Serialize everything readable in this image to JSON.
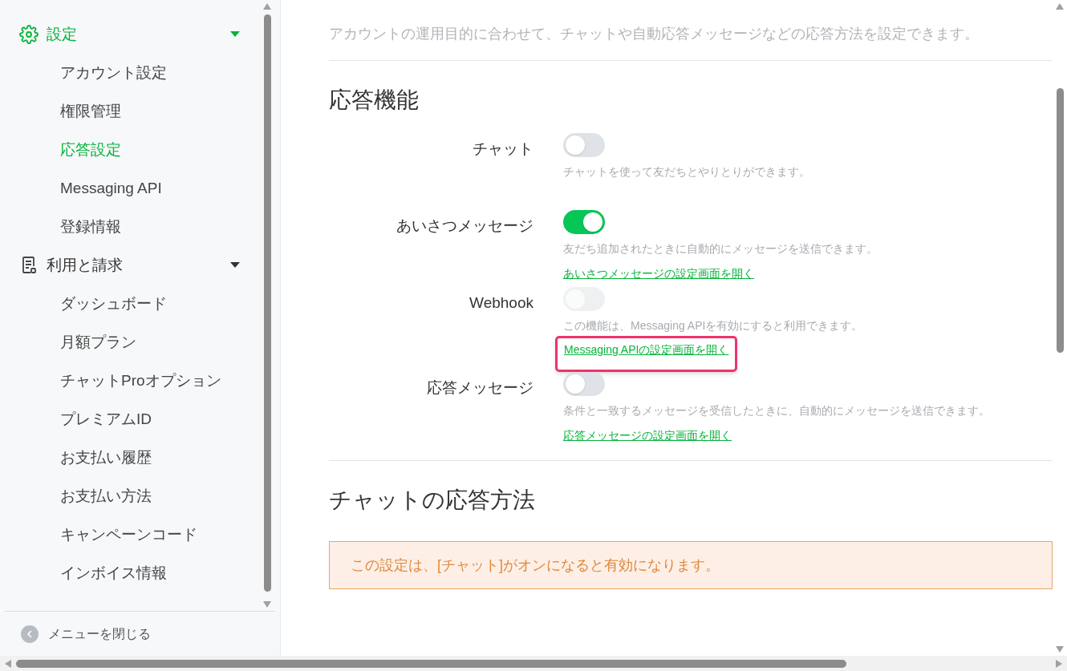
{
  "sidebar": {
    "sections": [
      {
        "label": "設定",
        "expanded": true,
        "selected": true,
        "items": [
          {
            "label": "アカウント設定",
            "selected": false
          },
          {
            "label": "権限管理",
            "selected": false
          },
          {
            "label": "応答設定",
            "selected": true
          },
          {
            "label": "Messaging API",
            "selected": false
          },
          {
            "label": "登録情報",
            "selected": false
          }
        ]
      },
      {
        "label": "利用と請求",
        "expanded": true,
        "selected": false,
        "items": [
          {
            "label": "ダッシュボード",
            "selected": false
          },
          {
            "label": "月額プラン",
            "selected": false
          },
          {
            "label": "チャットProオプション",
            "selected": false
          },
          {
            "label": "プレミアムID",
            "selected": false
          },
          {
            "label": "お支払い履歴",
            "selected": false
          },
          {
            "label": "お支払い方法",
            "selected": false
          },
          {
            "label": "キャンペーンコード",
            "selected": false
          },
          {
            "label": "インボイス情報",
            "selected": false
          }
        ]
      }
    ],
    "close_menu": "メニューを閉じる"
  },
  "page": {
    "description": "アカウントの運用目的に合わせて、チャットや自動応答メッセージなどの応答方法を設定できます。"
  },
  "response_features": {
    "heading": "応答機能",
    "rows": [
      {
        "label": "チャット",
        "on": false,
        "disabled": false,
        "description": "チャットを使って友だちとやりとりができます。"
      },
      {
        "label": "あいさつメッセージ",
        "on": true,
        "disabled": false,
        "description": "友だち追加されたときに自動的にメッセージを送信できます。",
        "link": "あいさつメッセージの設定画面を開く",
        "highlighted": false
      },
      {
        "label": "Webhook",
        "on": false,
        "disabled": true,
        "description": "この機能は、Messaging APIを有効にすると利用できます。",
        "link": "Messaging APIの設定画面を開く",
        "highlighted": true
      },
      {
        "label": "応答メッセージ",
        "on": false,
        "disabled": false,
        "description": "条件と一致するメッセージを受信したときに、自動的にメッセージを送信できます。",
        "link": "応答メッセージの設定画面を開く",
        "highlighted": false
      }
    ]
  },
  "chat_response": {
    "heading": "チャットの応答方法",
    "notice": "この設定は、[チャット]がオンになると有効になります。"
  }
}
